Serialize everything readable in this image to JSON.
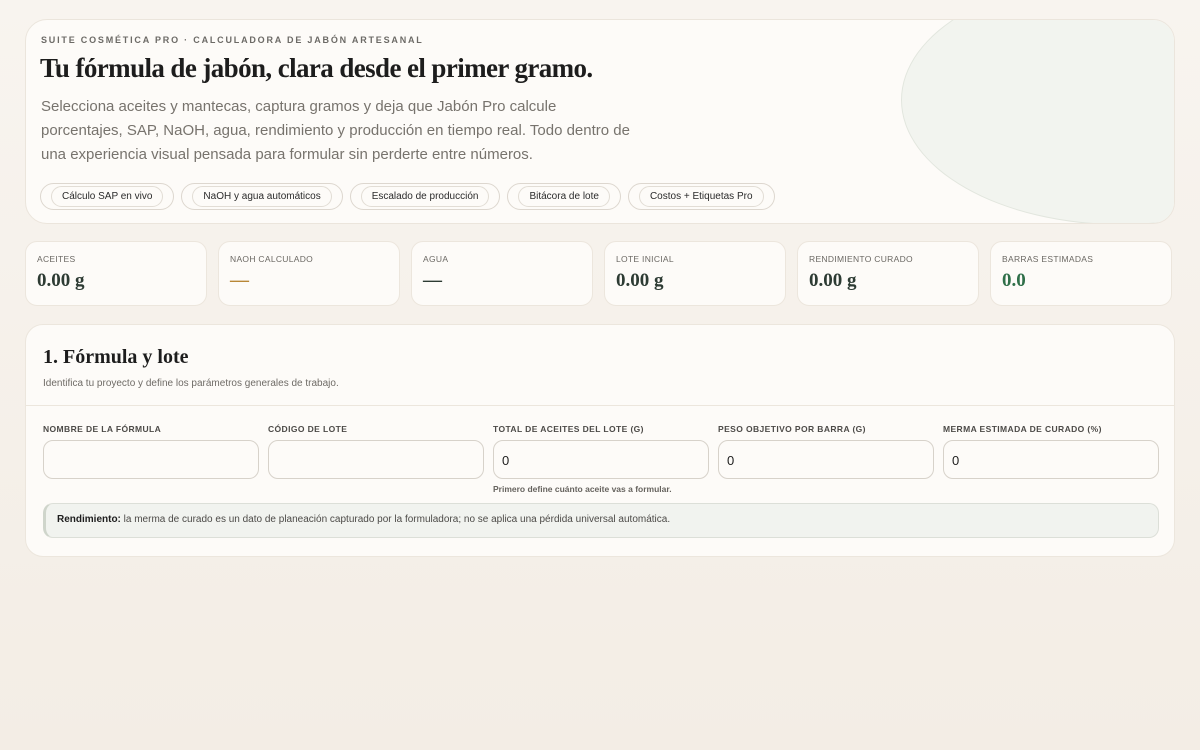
{
  "hero": {
    "eyebrow": "SUITE COSMÉTICA PRO · CALCULADORA DE JABÓN ARTESANAL",
    "title": "Tu fórmula de jabón, clara desde el primer gramo.",
    "description": "Selecciona aceites y mantecas, captura gramos y deja que Jabón Pro calcule porcentajes, SAP, NaOH, agua, rendimiento y producción en tiempo real. Todo dentro de una experiencia visual pensada para formular sin perderte entre números.",
    "chips": [
      "Cálculo SAP en vivo",
      "NaOH y agua automáticos",
      "Escalado de producción",
      "Bitácora de lote",
      "Costos + Etiquetas Pro"
    ]
  },
  "stats": [
    {
      "label": "ACEITES",
      "value": "0.00 g"
    },
    {
      "label": "NAOH CALCULADO",
      "value": "—"
    },
    {
      "label": "AGUA",
      "value": "—"
    },
    {
      "label": "LOTE INICIAL",
      "value": "0.00 g"
    },
    {
      "label": "RENDIMIENTO CURADO",
      "value": "0.00 g"
    },
    {
      "label": "BARRAS ESTIMADAS",
      "value": "0.0"
    }
  ],
  "colors": {
    "background": "#f6f1ea",
    "accent_gold": "#b88736",
    "accent_green": "#2f6f49",
    "card": "#fdfbf8"
  },
  "panel": {
    "title": "1. Fórmula y lote",
    "subtitle": "Identifica tu proyecto y define los parámetros generales de trabajo.",
    "fields": [
      {
        "label": "NOMBRE DE LA FÓRMULA",
        "value": "",
        "help": ""
      },
      {
        "label": "CÓDIGO DE LOTE",
        "value": "",
        "help": ""
      },
      {
        "label": "TOTAL DE ACEITES DEL LOTE (G)",
        "value": "0",
        "help": "Primero define cuánto aceite vas a formular."
      },
      {
        "label": "PESO OBJETIVO POR BARRA (G)",
        "value": "0",
        "help": ""
      },
      {
        "label": "MERMA ESTIMADA DE CURADO (%)",
        "value": "0",
        "help": ""
      }
    ],
    "callout": {
      "strong": "Rendimiento:",
      "text": " la merma de curado es un dato de planeación capturado por la formuladora; no se aplica una pérdida universal automática."
    }
  }
}
